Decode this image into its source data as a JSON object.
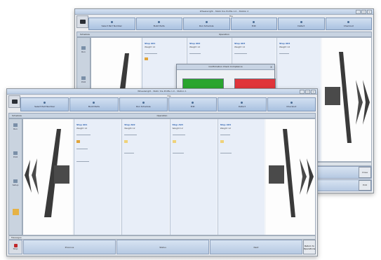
{
  "back_window": {
    "title": "Wheelwright - Static tire Profile 1.0 – Station 2",
    "menu": "File",
    "logo_text": "",
    "toolbar": [
      "Select Part Number",
      "Build Parts",
      "Run Schedule",
      "Edit",
      "Defect",
      "Checkout"
    ],
    "header": {
      "left": "Schedule",
      "center": "Operation"
    },
    "sidebar": [
      "Run",
      "Edit",
      "Setup"
    ],
    "columns": [
      {
        "title": "Step A01",
        "subtitle": "Weight 12"
      },
      {
        "title": "Step A02",
        "subtitle": "Weight 12"
      },
      {
        "title": "Step A03",
        "subtitle": "Weight 12"
      },
      {
        "title": "Step A04",
        "subtitle": "Weight 12"
      }
    ],
    "status": "",
    "footer": [
      "",
      ""
    ],
    "footer_actions": [
      "Close",
      "Edit"
    ],
    "dialog": {
      "title": "Confirmation Check Compliance",
      "close": "×",
      "colors": {
        "ok": "#2aa52e",
        "cancel": "#e0353a"
      }
    }
  },
  "front_window": {
    "title": "Wheelwright - Static tire Profile 1.0 – Station 1",
    "menu": "File",
    "logo_text": "",
    "toolbar": [
      "Select Part Number",
      "Build Parts",
      "Run Schedule",
      "Edit",
      "Defect",
      "Checkout"
    ],
    "header": {
      "left": "Schedule",
      "center": "Operation"
    },
    "sidebar": [
      "Run",
      "Edit",
      "Setup",
      ""
    ],
    "columns": [
      {
        "title": "Step A01",
        "subtitle": "Weight 12"
      },
      {
        "title": "Step A02",
        "subtitle": "Weight 12"
      },
      {
        "title": "Step A03",
        "subtitle": "Weight 12"
      },
      {
        "title": "Step A04",
        "subtitle": "Weight 12"
      }
    ],
    "status": "Messages",
    "footer": [
      "Stop",
      "Previous",
      "Status",
      "Next"
    ],
    "footer_action": "Return to Operations",
    "colors": {
      "stop": "#c0282a",
      "accent": "#2f63b0",
      "marker": "#e0a43a"
    }
  }
}
